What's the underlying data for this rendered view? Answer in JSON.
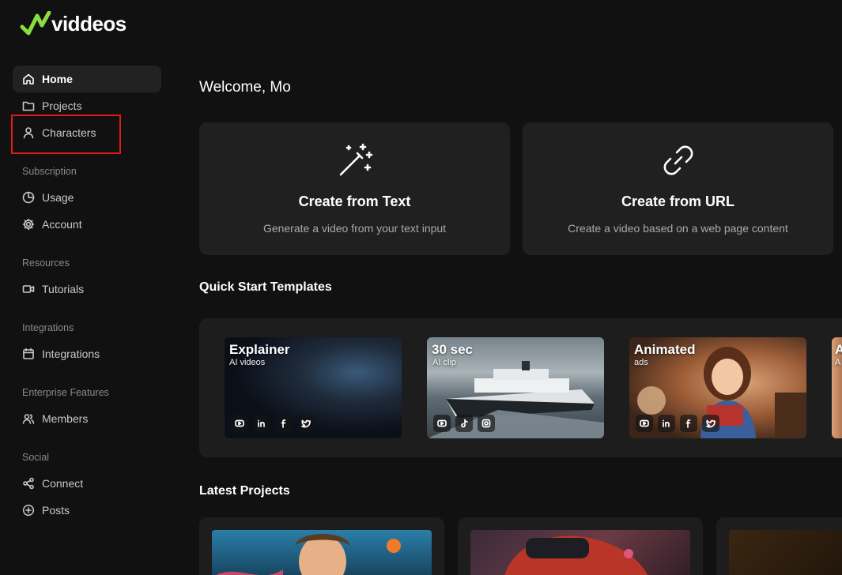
{
  "brand": {
    "name": "viddeos",
    "accent": "#8bdd3c"
  },
  "sidebar": {
    "items": [
      {
        "label": "Home",
        "icon": "home-icon"
      },
      {
        "label": "Projects",
        "icon": "folder-icon"
      },
      {
        "label": "Characters",
        "icon": "user-icon"
      },
      {
        "label": "Usage",
        "icon": "pie-chart-icon"
      },
      {
        "label": "Account",
        "icon": "gear-icon"
      },
      {
        "label": "Tutorials",
        "icon": "video-camera-icon"
      },
      {
        "label": "Integrations",
        "icon": "calendar-icon"
      },
      {
        "label": "Members",
        "icon": "users-icon"
      },
      {
        "label": "Connect",
        "icon": "share-icon"
      },
      {
        "label": "Posts",
        "icon": "plus-circle-icon"
      }
    ],
    "sections": [
      "Subscription",
      "Resources",
      "Integrations",
      "Enterprise Features",
      "Social"
    ],
    "highlight_color": "#e01919"
  },
  "main": {
    "welcome": "Welcome, Mo",
    "create_cards": [
      {
        "title": "Create from Text",
        "subtitle": "Generate a video from your text input",
        "icon": "magic-wand-icon"
      },
      {
        "title": "Create from URL",
        "subtitle": "Create a video based on a web page content",
        "icon": "link-icon"
      }
    ],
    "templates_title": "Quick Start Templates",
    "templates": [
      {
        "title": "Explainer",
        "subtitle": "AI videos"
      },
      {
        "title": "30 sec",
        "subtitle": "AI clip"
      },
      {
        "title": "Animated",
        "subtitle": "ads"
      },
      {
        "title": "A",
        "subtitle": "A"
      }
    ],
    "projects_title": "Latest Projects"
  }
}
